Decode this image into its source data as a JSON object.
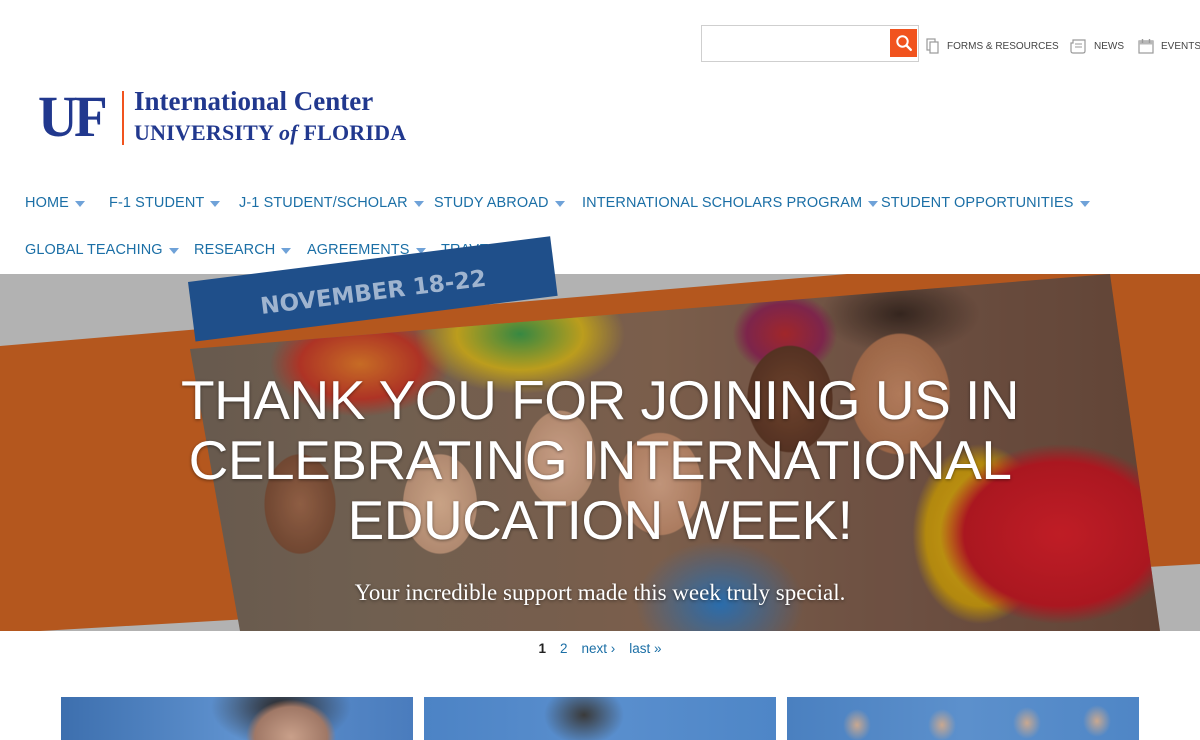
{
  "search": {
    "placeholder": "",
    "value": "",
    "button_icon": "search-icon"
  },
  "utility_links": [
    {
      "label": "FORMS & RESOURCES",
      "icon": "documents-icon"
    },
    {
      "label": "NEWS",
      "icon": "newspaper-icon"
    },
    {
      "label": "EVENTS",
      "icon": "calendar-icon"
    }
  ],
  "logo": {
    "mark": "UF",
    "line1": "International Center",
    "line2_part1": "UNIVERSITY ",
    "line2_italic": "of",
    "line2_part2": " FLORIDA"
  },
  "nav": {
    "row1": [
      "HOME",
      "F-1 STUDENT",
      "J-1 STUDENT/SCHOLAR",
      "STUDY ABROAD",
      "INTERNATIONAL SCHOLARS PROGRAM",
      "STUDENT OPPORTUNITIES"
    ],
    "row2": [
      "GLOBAL TEACHING",
      "RESEARCH",
      "AGREEMENTS",
      "TRAVEL"
    ]
  },
  "hero": {
    "badge": "NOVEMBER 18-22",
    "title_line1": "THANK YOU FOR JOINING US IN",
    "title_line2": "CELEBRATING INTERNATIONAL",
    "title_line3": "EDUCATION WEEK!",
    "subtitle": "Your incredible support made this week truly special."
  },
  "pager": {
    "current": "1",
    "page2": "2",
    "next": "next ›",
    "last": "last »"
  },
  "colors": {
    "brand_blue": "#21388e",
    "brand_orange": "#f1531e",
    "link_blue": "#1b6fa6",
    "caret_blue": "#6fa2d8",
    "hero_orange": "#b4571e",
    "badge_blue": "#1f4f8a"
  }
}
